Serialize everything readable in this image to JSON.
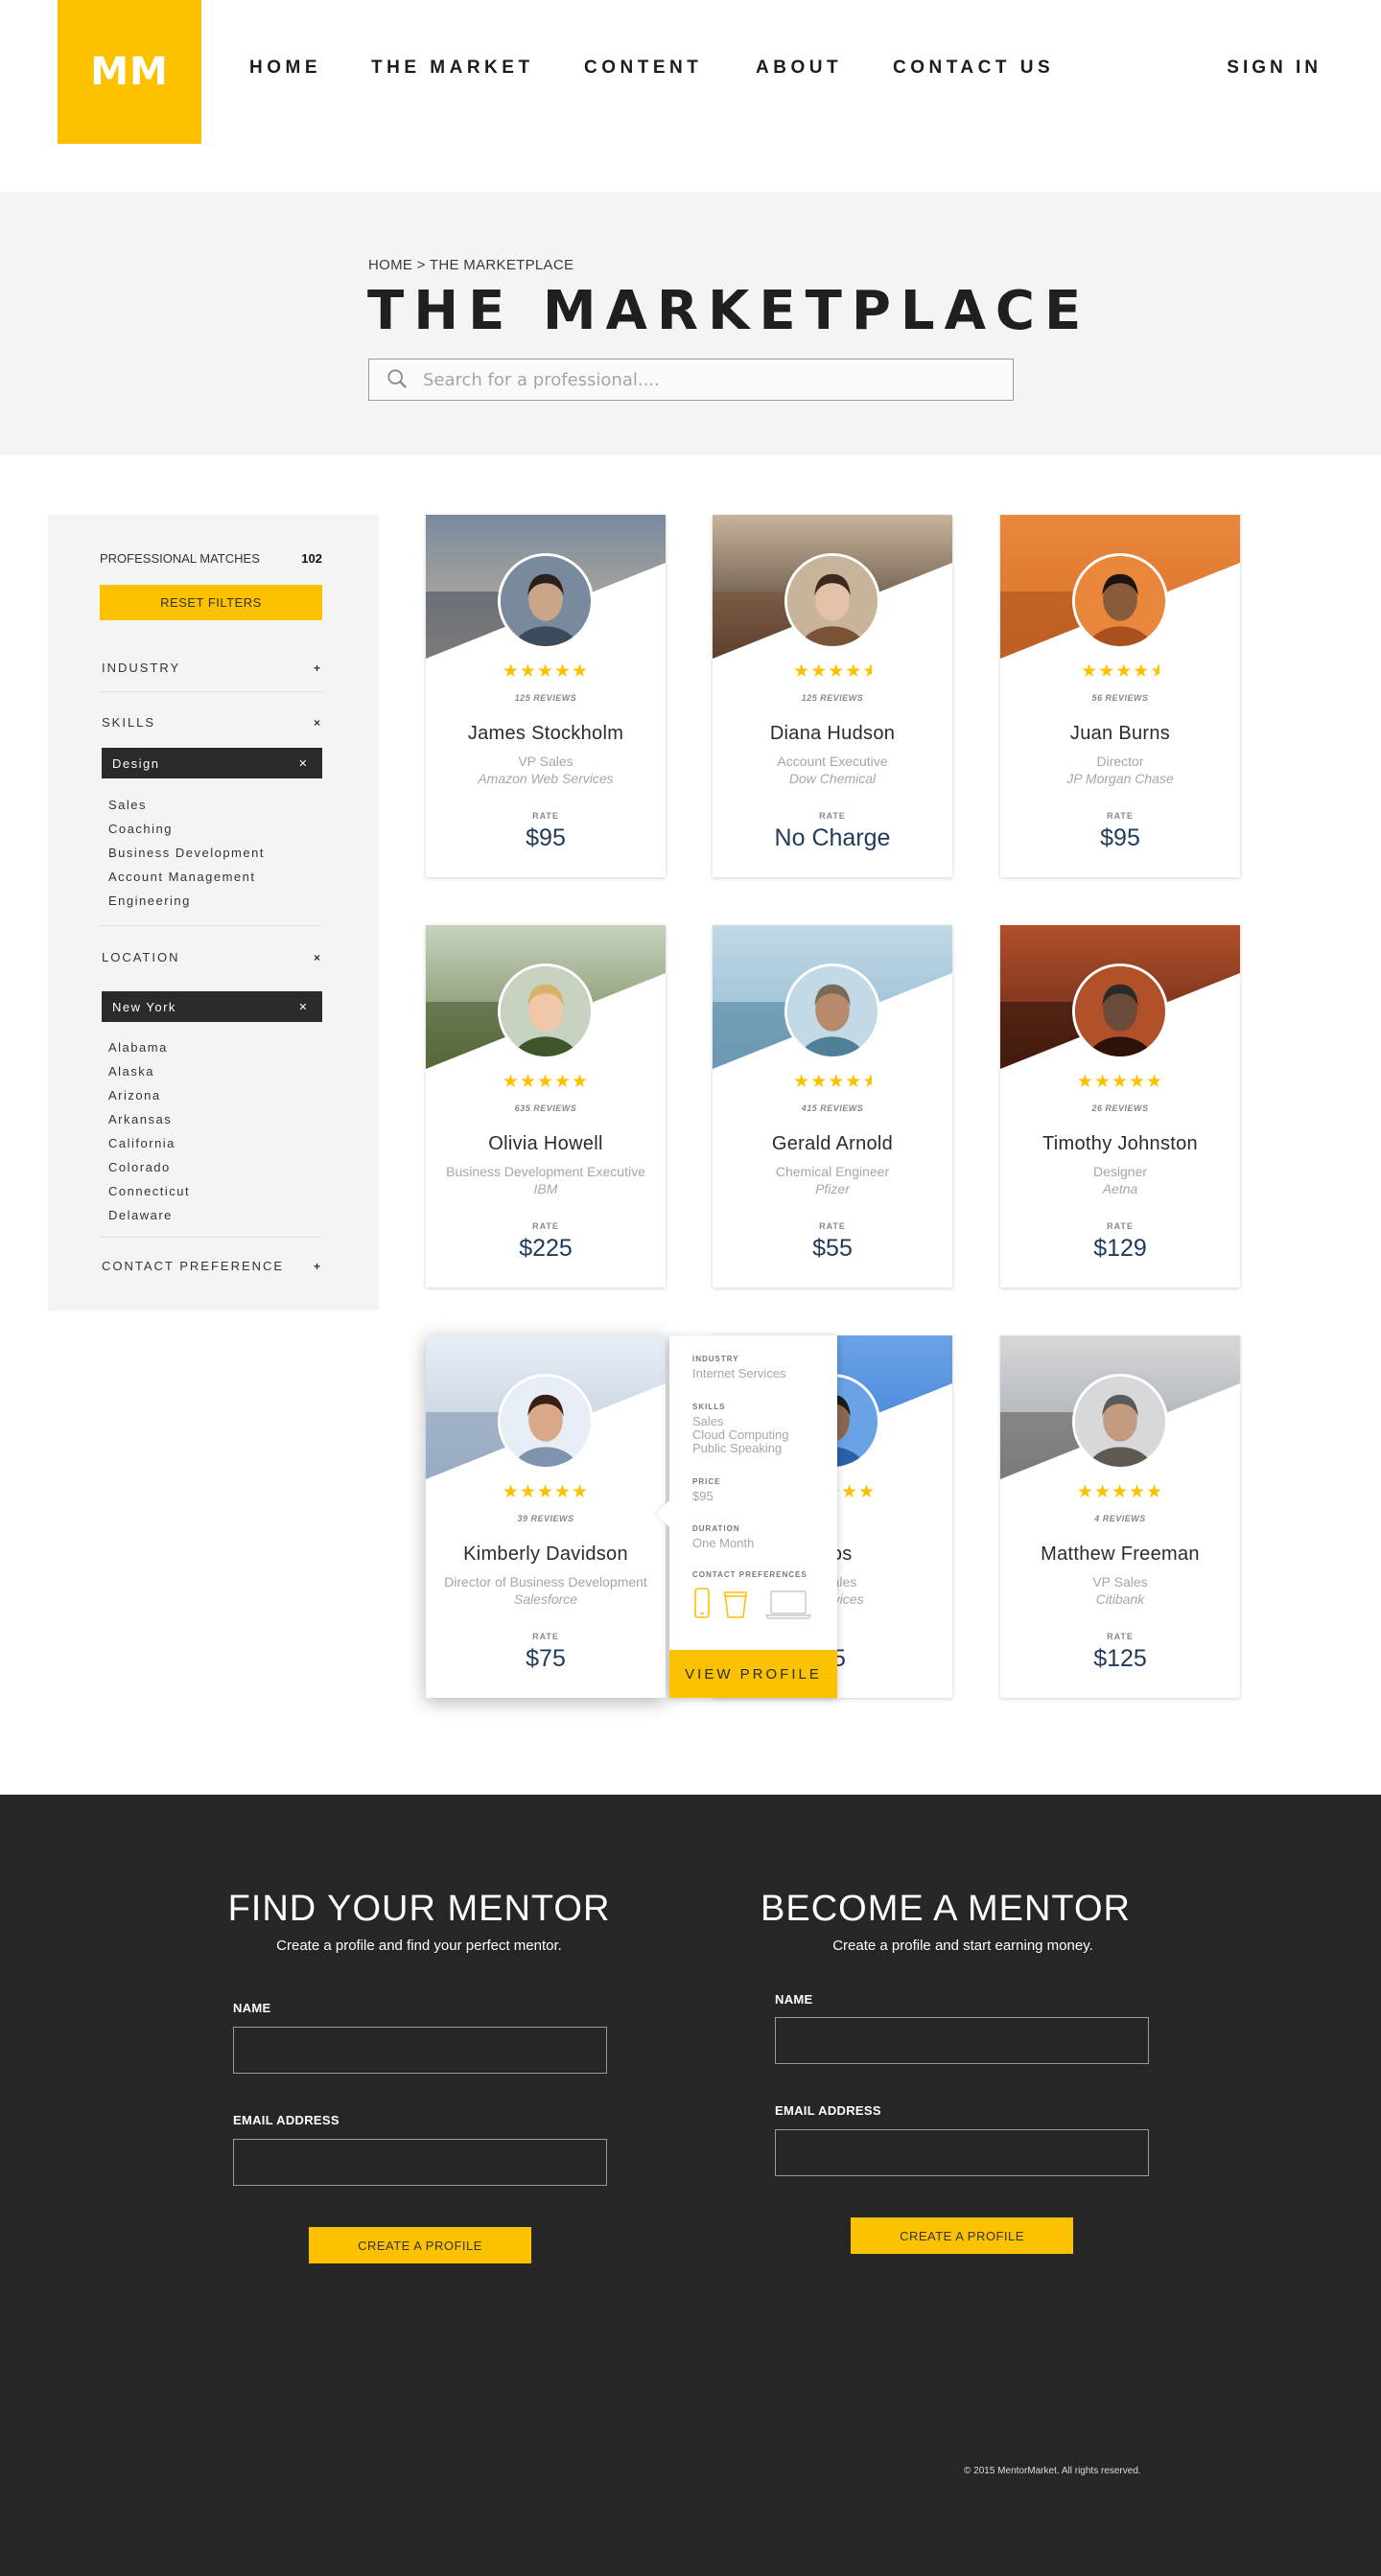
{
  "header": {
    "logo": "MM",
    "nav": [
      "HOME",
      "THE MARKET",
      "CONTENT",
      "ABOUT",
      "CONTACT US"
    ],
    "sign_in": "SIGN IN"
  },
  "hero": {
    "breadcrumb": "HOME > THE MARKETPLACE",
    "title": "THE MARKETPLACE",
    "search_placeholder": "Search for a professional...."
  },
  "filters": {
    "matches_label": "PROFESSIONAL MATCHES",
    "matches_count": "102",
    "reset_label": "RESET FILTERS",
    "industry": {
      "label": "INDUSTRY",
      "toggle": "+"
    },
    "skills": {
      "label": "SKILLS",
      "toggle": "×",
      "selected": "Design",
      "options": [
        "Sales",
        "Coaching",
        "Business Development",
        "Account Management",
        "Engineering"
      ]
    },
    "location": {
      "label": "LOCATION",
      "toggle": "×",
      "selected": "New York",
      "options": [
        "Alabama",
        "Alaska",
        "Arizona",
        "Arkansas",
        "California",
        "Colorado",
        "Connecticut",
        "Delaware"
      ]
    },
    "contact": {
      "label": "CONTACT PREFERENCE",
      "toggle": "+"
    }
  },
  "cards": [
    {
      "name": "James Stockholm",
      "role": "VP Sales",
      "company": "Amazon Web Services",
      "reviews": "125 REVIEWS",
      "rating": 5,
      "rate_label": "RATE",
      "rate": "$95"
    },
    {
      "name": "Diana Hudson",
      "role": "Account Executive",
      "company": "Dow Chemical",
      "reviews": "125 REVIEWS",
      "rating": 4.5,
      "rate_label": "RATE",
      "rate": "No Charge"
    },
    {
      "name": "Juan Burns",
      "role": "Director",
      "company": "JP Morgan Chase",
      "reviews": "56 REVIEWS",
      "rating": 4.5,
      "rate_label": "RATE",
      "rate": "$95"
    },
    {
      "name": "Olivia Howell",
      "role": "Business Development Executive",
      "company": "IBM",
      "reviews": "635 REVIEWS",
      "rating": 5,
      "rate_label": "RATE",
      "rate": "$225"
    },
    {
      "name": "Gerald Arnold",
      "role": "Chemical Engineer",
      "company": "Pfizer",
      "reviews": "415 REVIEWS",
      "rating": 4.5,
      "rate_label": "RATE",
      "rate": "$55"
    },
    {
      "name": "Timothy Johnston",
      "role": "Designer",
      "company": "Aetna",
      "reviews": "26 REVIEWS",
      "rating": 5,
      "rate_label": "RATE",
      "rate": "$129"
    },
    {
      "name": "Kimberly Davidson",
      "role": "Director of Business Development",
      "company": "Salesforce",
      "reviews": "39 REVIEWS",
      "rating": 5,
      "rate_label": "RATE",
      "rate": "$75"
    },
    {
      "name": "Rios",
      "role": "of Sales",
      "company": "b Services",
      "reviews": "",
      "rating": 5,
      "rate_label": "E",
      "rate": "15"
    },
    {
      "name": "Matthew Freeman",
      "role": "VP Sales",
      "company": "Citibank",
      "reviews": "4 REVIEWS",
      "rating": 5,
      "rate_label": "RATE",
      "rate": "$125"
    }
  ],
  "popover": {
    "industry_label": "INDUSTRY",
    "industry": "Internet Services",
    "skills_label": "SKILLS",
    "skills": [
      "Sales",
      "Cloud Computing",
      "Public Speaking"
    ],
    "price_label": "PRICE",
    "price": "$95",
    "duration_label": "DURATION",
    "duration": "One Month",
    "contact_label": "CONTACT PREFERENCES",
    "contact_icons": [
      "phone-icon",
      "coffee-cup-icon",
      "laptop-icon"
    ],
    "button": "VIEW PROFILE"
  },
  "footer": {
    "find": {
      "title": "FIND YOUR MENTOR",
      "subtitle": "Create a profile and find your perfect mentor.",
      "name_label": "NAME",
      "email_label": "EMAIL ADDRESS",
      "button": "CREATE A PROFILE"
    },
    "become": {
      "title": "BECOME A MENTOR",
      "subtitle": "Create a profile and start earning money.",
      "name_label": "NAME",
      "email_label": "EMAIL ADDRESS",
      "button": "CREATE A PROFILE"
    },
    "copyright": "© 2015 MentorMarket. All rights reserved."
  },
  "colors": {
    "accent": "#fcc200",
    "dark": "#262626",
    "rate_text": "#1f3a5c",
    "light_bg": "#f4f4f4"
  }
}
